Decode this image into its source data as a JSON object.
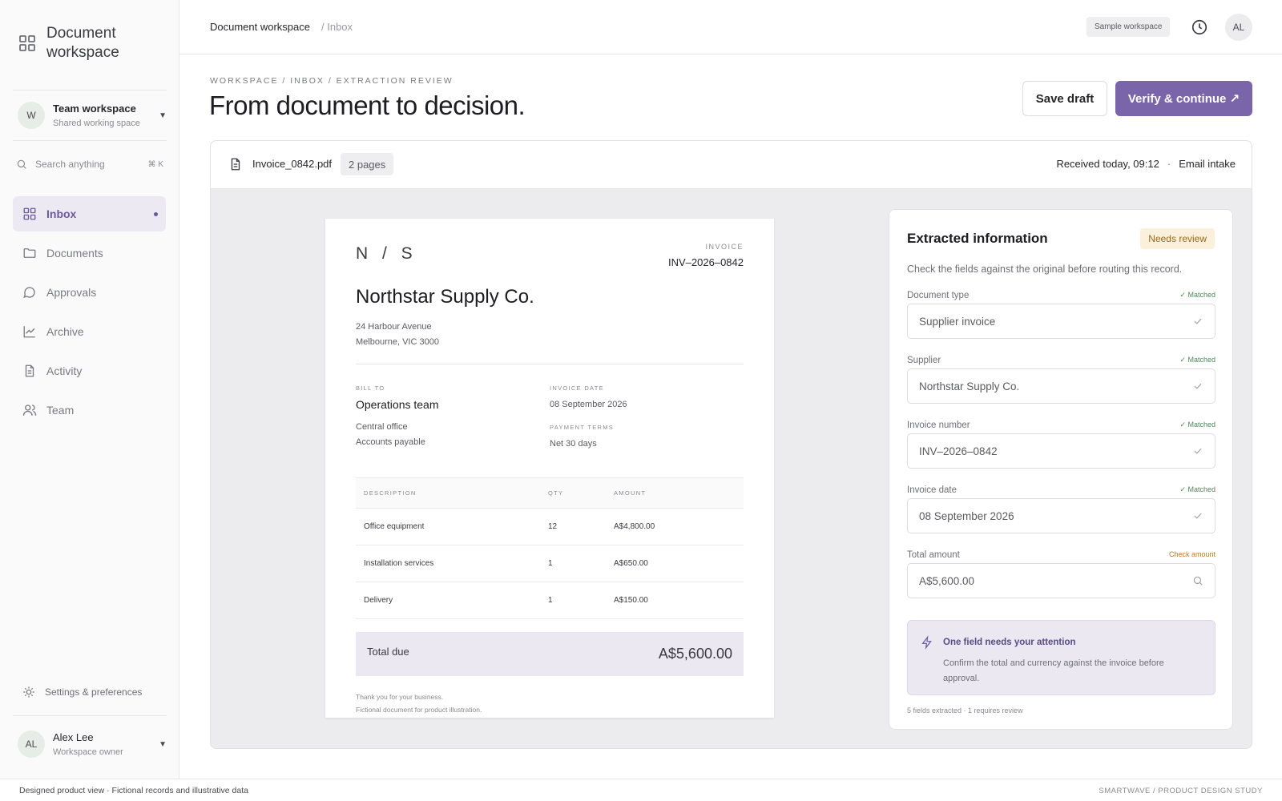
{
  "app": {
    "brand_title": "Document workspace"
  },
  "sidebar": {
    "team": {
      "initial": "W",
      "name": "Team workspace",
      "sub": "Shared working space"
    },
    "search": {
      "placeholder": "Search anything",
      "shortcut": "⌘ K"
    },
    "items": [
      {
        "label": "Inbox",
        "icon": "grid-icon",
        "active": true
      },
      {
        "label": "Documents",
        "icon": "folder-icon"
      },
      {
        "label": "Approvals",
        "icon": "chat-bubble-icon"
      },
      {
        "label": "Archive",
        "icon": "chart-line-icon"
      },
      {
        "label": "Activity",
        "icon": "file-icon"
      },
      {
        "label": "Team",
        "icon": "users-icon"
      }
    ],
    "settings_label": "Settings & preferences",
    "user": {
      "initials": "AL",
      "name": "Alex Lee",
      "role": "Workspace owner"
    }
  },
  "topbar": {
    "crumb_root": "Document workspace",
    "crumb_current": "/ Inbox",
    "workspace_badge": "Sample workspace",
    "avatar_initials": "AL"
  },
  "header": {
    "eyebrow": "WORKSPACE / INBOX / EXTRACTION REVIEW",
    "title": "From document to decision.",
    "save_label": "Save draft",
    "verify_label": "Verify & continue ↗"
  },
  "document": {
    "filename": "Invoice_0842.pdf",
    "pages": "2 pages",
    "received": "Received today, 09:12",
    "separator": "·",
    "source": "Email intake"
  },
  "invoice": {
    "monogram": "N / S",
    "label": "INVOICE",
    "number": "INV–2026–0842",
    "company": "Northstar Supply Co.",
    "address_line1": "24 Harbour Avenue",
    "address_line2": "Melbourne, VIC 3000",
    "bill_to_label": "BILL TO",
    "bill_to_name": "Operations team",
    "bill_to_line1": "Central office",
    "bill_to_line2": "Accounts payable",
    "date_label": "INVOICE DATE",
    "date_value": "08 September 2026",
    "terms_label": "PAYMENT TERMS",
    "terms_value": "Net 30 days",
    "columns": [
      "DESCRIPTION",
      "QTY",
      "AMOUNT"
    ],
    "rows": [
      {
        "description": "Office equipment",
        "qty": "12",
        "amount": "A$4,800.00"
      },
      {
        "description": "Installation services",
        "qty": "1",
        "amount": "A$650.00"
      },
      {
        "description": "Delivery",
        "qty": "1",
        "amount": "A$150.00"
      }
    ],
    "total_label": "Total due",
    "total_value": "A$5,600.00",
    "thanks": "Thank you for your business.",
    "disclaimer": "Fictional document for product illustration."
  },
  "extracted": {
    "title": "Extracted information",
    "badge": "Needs review",
    "subtitle": "Check the fields against the original before routing this record.",
    "fields": [
      {
        "label": "Document type",
        "status": "✓ Matched",
        "value": "Supplier invoice"
      },
      {
        "label": "Supplier",
        "status": "✓ Matched",
        "value": "Northstar Supply Co."
      },
      {
        "label": "Invoice number",
        "status": "✓ Matched",
        "value": "INV–2026–0842"
      },
      {
        "label": "Invoice date",
        "status": "✓ Matched",
        "value": "08 September 2026"
      },
      {
        "label": "Total amount",
        "status": "Check amount",
        "value": "A$5,600.00"
      }
    ],
    "attention_title": "One field needs your attention",
    "attention_body": "Confirm the total and currency against the invoice before approval.",
    "footer": "5 fields extracted · 1 requires review"
  },
  "footer": {
    "left": "Designed product view · Fictional records and illustrative data",
    "right": "SMARTWAVE / PRODUCT DESIGN STUDY"
  },
  "colors": {
    "accent": "#7a65aa",
    "matched": "#4a8a5a",
    "warning": "#c07a2a",
    "badge_bg": "#fbf0dc"
  }
}
